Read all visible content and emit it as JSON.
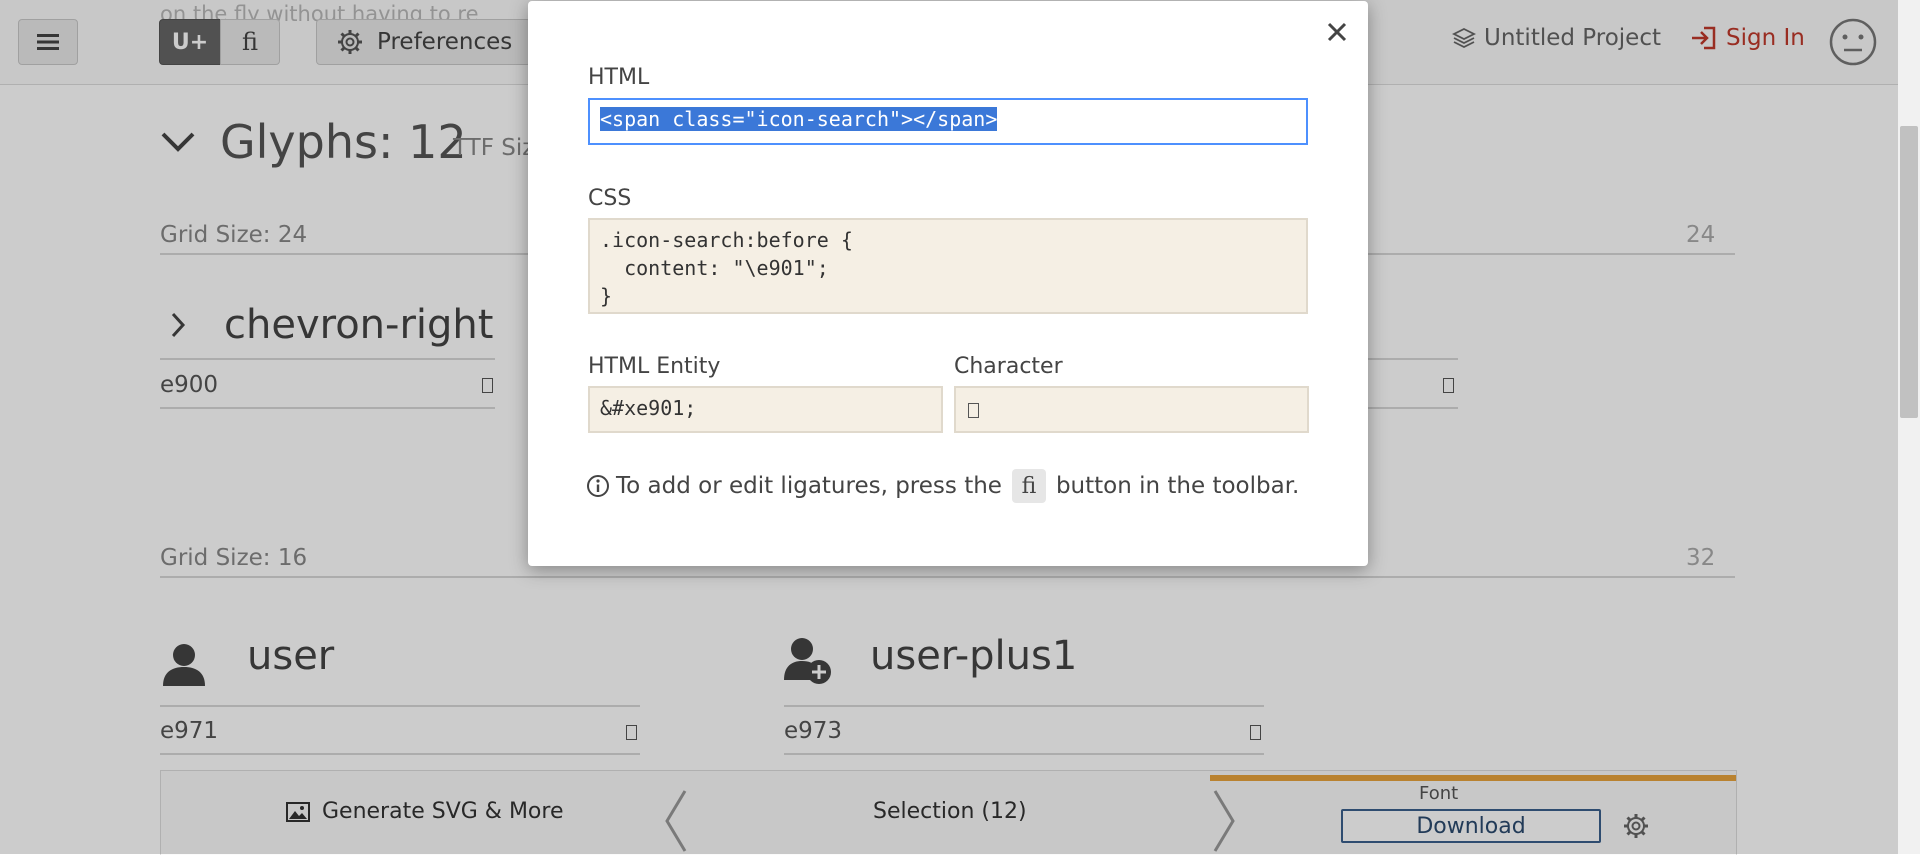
{
  "toolbar": {
    "unicode_btn": "U+",
    "ligature_btn": "fi",
    "preferences": "Preferences",
    "faded_text": "on the fly without having to re",
    "project": "Untitled Project",
    "sign_in": "Sign In"
  },
  "section": {
    "title": "Glyphs: 12",
    "subtitle": "TTF Siz"
  },
  "grid24": {
    "label": "Grid Size: 24",
    "right": "24"
  },
  "glyph1": {
    "name": "chevron-right",
    "code": "e900"
  },
  "grid16": {
    "label": "Grid Size: 16",
    "right": "32"
  },
  "glyph_user": {
    "name": "user",
    "code": "e971"
  },
  "glyph_userplus": {
    "name": "user-plus1",
    "code": "e973"
  },
  "bottom": {
    "generate": "Generate SVG & More",
    "selection": "Selection (12)",
    "font_label": "Font",
    "download": "Download"
  },
  "modal": {
    "html_label": "HTML",
    "html_value": "<span class=\"icon-search\"></span>",
    "css_label": "CSS",
    "css_value": ".icon-search:before {\n  content: \"\\e901\";\n}",
    "entity_label": "HTML Entity",
    "entity_value": "&#xe901;",
    "char_label": "Character",
    "info_before": "To add or edit ligatures, press the",
    "info_chip": "fi",
    "info_after": "button in the toolbar."
  },
  "colors": {
    "accent_blue": "#4d90fe",
    "sign_in_red": "#c0392b",
    "progress_orange": "#e8a33c",
    "field_beige": "#f5efe4"
  }
}
